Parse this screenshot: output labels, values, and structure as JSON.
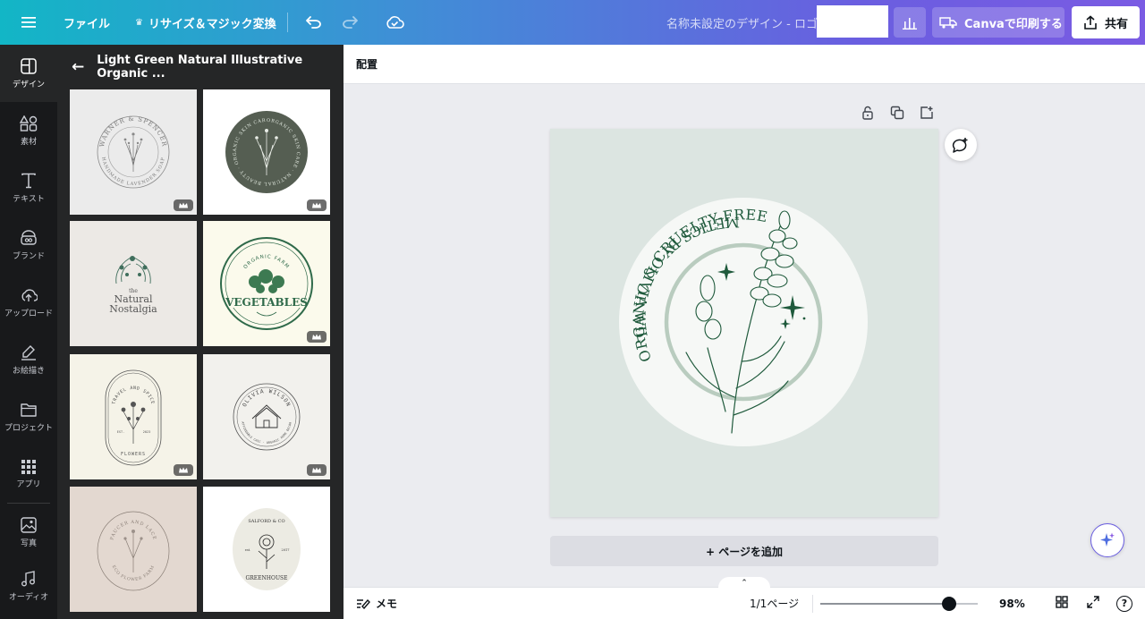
{
  "topbar": {
    "file": "ファイル",
    "resize": "リサイズ＆マジック変換",
    "doc_title": "名称未設定のデザイン - ロゴ",
    "print": "Canvaで印刷する",
    "share": "共有"
  },
  "rail": [
    {
      "label": "デザイン",
      "icon": "design-icon"
    },
    {
      "label": "素材",
      "icon": "elements-icon"
    },
    {
      "label": "テキスト",
      "icon": "text-icon"
    },
    {
      "label": "ブランド",
      "icon": "brand-icon"
    },
    {
      "label": "アップロード",
      "icon": "upload-icon"
    },
    {
      "label": "お絵描き",
      "icon": "draw-icon"
    },
    {
      "label": "プロジェクト",
      "icon": "folder-icon"
    },
    {
      "label": "アプリ",
      "icon": "apps-icon"
    },
    {
      "label": "写真",
      "icon": "photo-icon"
    },
    {
      "label": "オーディオ",
      "icon": "audio-icon"
    }
  ],
  "panel": {
    "title": "Light Green Natural Illustrative Organic ...",
    "templates": {
      "t1": {
        "line1": "WARNER & SPENCER",
        "line2": "HANDMADE LAVENDER SOAP"
      },
      "t2": {
        "line1": "ORGANIC SKIN CARE · NATURAL BEAUTY · ORGANIC SKIN CARE · NATURAL BEAUTY"
      },
      "t3": {
        "line1": "the",
        "line2": "Natural",
        "line3": "Nostalgia"
      },
      "t4": {
        "line1": "ORGANIC FARM",
        "line2": "VEGETABLES"
      },
      "t5": {
        "line1": "TRAVEL AND SPICE",
        "line2": "EST.",
        "line3": "2023",
        "line4": "FLOWERS"
      },
      "t6": {
        "line1": "OLIVIA WILSON",
        "line2": "AFFORDABLE CHIC · ORGANIC HOME DECOR"
      },
      "t7": {
        "line1": "PAUCER AND LACE",
        "line2": "ECO FLOWER FARM"
      },
      "t8": {
        "line1": "SALFORD & CO",
        "line2": "est.",
        "line3": "2017",
        "line4": "GREENHOUSE"
      }
    }
  },
  "secbar": {
    "position": "配置"
  },
  "canvas": {
    "top_text": "ORGANIC & CRUELTY-FREE",
    "bottom_text": "COSMETICS BY OLIVIA WILSON",
    "add_page": "+ ページを追加"
  },
  "bottombar": {
    "notes": "メモ",
    "page_count": "1/1ページ",
    "zoom": "98%",
    "zoom_level": 0.82
  },
  "colors": {
    "logo_green": "#1f5a3c",
    "logo_bg": "#dce5e1"
  }
}
